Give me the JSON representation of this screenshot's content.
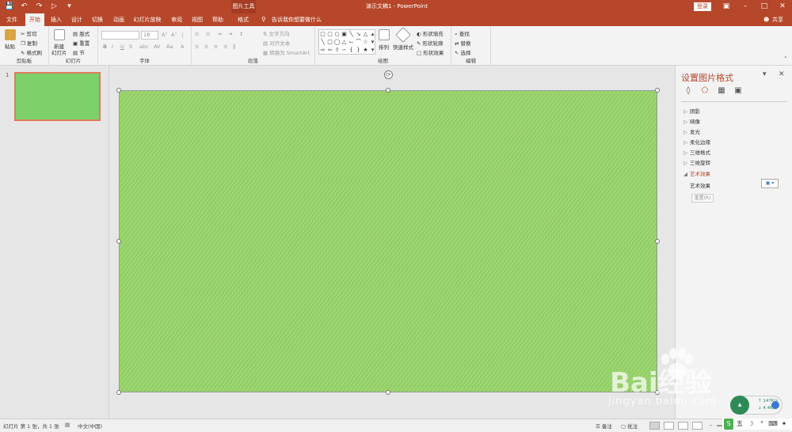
{
  "titlebar": {
    "context_tab": "图片工具",
    "doc_title": "演示文稿1 - PowerPoint",
    "login": "登录",
    "colors": {
      "bar": "#b7472a"
    }
  },
  "tabs": {
    "items": [
      "文件",
      "开始",
      "插入",
      "设计",
      "切换",
      "动画",
      "幻灯片放映",
      "审阅",
      "视图",
      "帮助",
      "格式"
    ],
    "active": "开始",
    "tellme": "告诉我你想要做什么",
    "share": "共享"
  },
  "ribbon": {
    "clipboard": {
      "label": "剪贴板",
      "paste": "粘贴",
      "cut": "剪切",
      "copy": "复制",
      "format_painter": "格式刷"
    },
    "slides": {
      "label": "幻灯片",
      "new_slide": "新建",
      "new_slide2": "幻灯片",
      "layout": "版式",
      "reset": "重置",
      "section": "节"
    },
    "font": {
      "label": "字体",
      "size": "18",
      "bold": "B",
      "italic": "I",
      "underline": "U",
      "strike": "S"
    },
    "paragraph": {
      "label": "段落",
      "text_direction": "文字方向",
      "align_text": "对齐文本",
      "smartart": "转换为 SmartArt"
    },
    "drawing": {
      "label": "绘图",
      "arrange": "排列",
      "quick_styles": "快速样式",
      "fill": "形状填充",
      "outline": "形状轮廓",
      "effects": "形状效果"
    },
    "editing": {
      "label": "编辑",
      "find": "查找",
      "replace": "替换",
      "select": "选择"
    }
  },
  "thumbs": {
    "slide_number": "1"
  },
  "format_pane": {
    "title": "设置图片格式",
    "sections": [
      "阴影",
      "映像",
      "发光",
      "柔化边缘",
      "三维格式",
      "三维旋转",
      "艺术效果"
    ],
    "open_section": "艺术效果",
    "artistic_label": "艺术效果",
    "reset": "重置(R)"
  },
  "status": {
    "slide_info": "幻灯片 第 1 张，共 1 张",
    "language": "中文(中国)",
    "notes": "备注",
    "comments": "批注"
  },
  "net": {
    "up": "147K/s",
    "down": "4.4K/s"
  },
  "watermark": {
    "brand": "Bai经验",
    "url": "jingyan.baidu.com"
  },
  "ime": {
    "label": "五"
  }
}
